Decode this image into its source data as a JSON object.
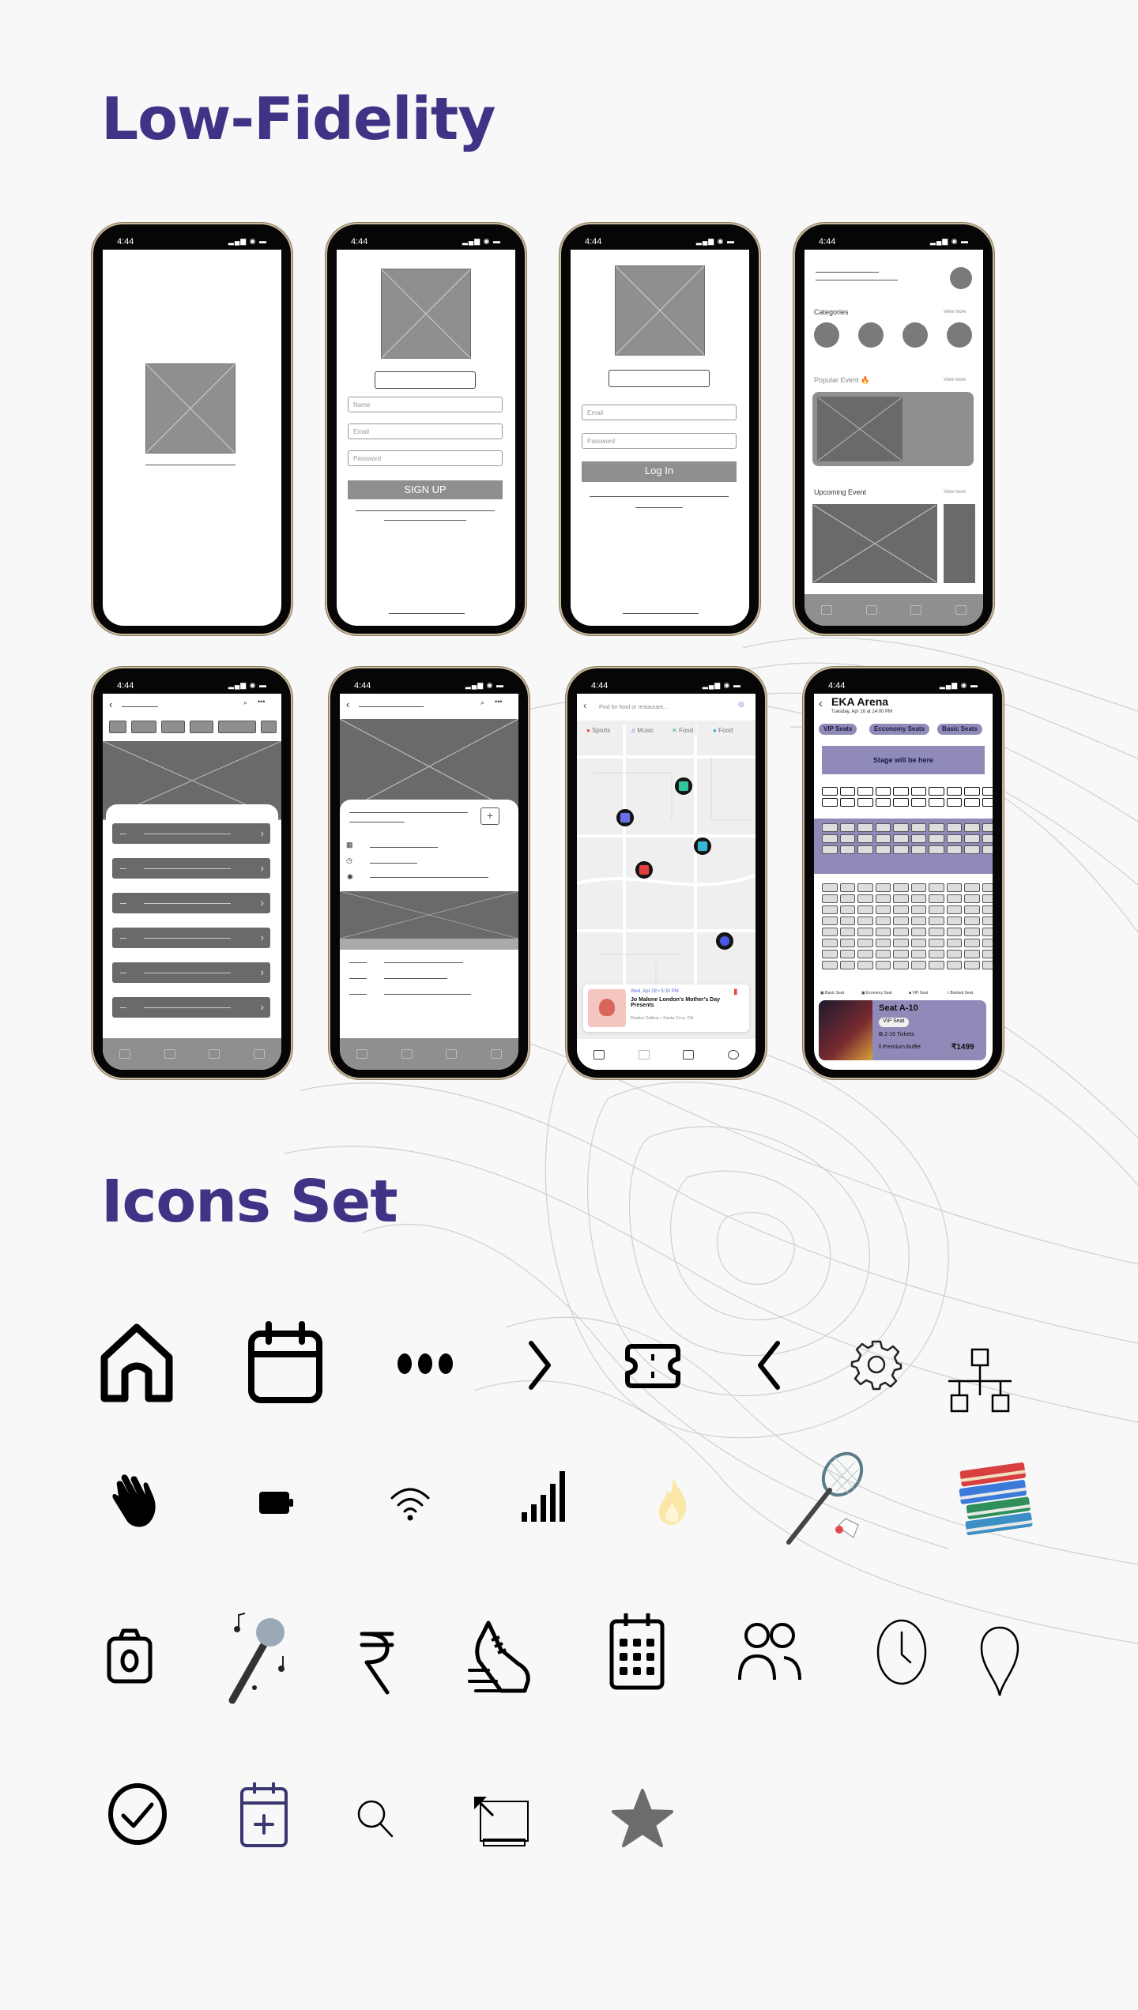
{
  "titles": {
    "low_fidelity": "Low-Fidelity",
    "icons_set": "Icons Set"
  },
  "status_bar": {
    "time": "4:44"
  },
  "screens": {
    "signup": {
      "name_placeholder": "Name",
      "email_placeholder": "Email",
      "password_placeholder": "Password",
      "signup_button": "SIGN UP"
    },
    "login": {
      "email_placeholder": "Email",
      "password_placeholder": "Password",
      "login_button": "Log In"
    },
    "home": {
      "categories": "Categories",
      "view_more": "View more",
      "popular_event": "Popular Event 🔥",
      "upcoming_event": "Upcoming Event"
    },
    "map": {
      "search_placeholder": "Find for food or restaurant...",
      "chips": [
        "Sports",
        "Music",
        "Food",
        "Food"
      ],
      "event_date": "Wed, Apr 28 • 5:30 PM",
      "event_title": "Jo Malone London's Mother's Day Presents",
      "event_location": "Radius Gallery • Santa Cruz, CA"
    },
    "seats": {
      "venue": "EKA Arena",
      "date": "Tuesday, Apr 16 at 14:00 PM",
      "tabs": [
        "VIP Seats",
        "Ecconomy Seats",
        "Basic Seats"
      ],
      "stage": "Stage will be here",
      "legend": [
        "Basic Seat",
        "Economy Seat",
        "VIP Seat",
        "Booked Seat"
      ],
      "seat_label": "Seat A-10",
      "seat_type": "VIP Seat",
      "tickets": "2-16 Tickets",
      "buffet": "Premium Buffet",
      "price": "₹1499"
    }
  },
  "icons": [
    "home-icon",
    "calendar-icon",
    "more-dots-icon",
    "chevron-right-icon",
    "ticket-icon",
    "chevron-left-icon",
    "gear-icon",
    "network-icon",
    "hand-wave-icon",
    "battery-icon",
    "wifi-icon",
    "signal-icon",
    "fire-icon",
    "badminton-icon",
    "books-icon",
    "camera-icon",
    "microphone-icon",
    "rupee-icon",
    "sneaker-icon",
    "calendar-grid-icon",
    "users-icon",
    "clock-icon",
    "location-pin-icon",
    "check-circle-icon",
    "calendar-add-icon",
    "search-icon",
    "window-resize-icon",
    "star-icon"
  ],
  "colors": {
    "title": "#3f3386",
    "seat_purple": "#8f8ab8",
    "background": "#f8f8f8"
  }
}
